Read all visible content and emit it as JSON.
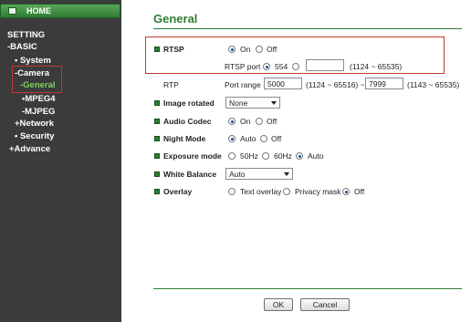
{
  "sidebar": {
    "home": "HOME",
    "items": [
      {
        "label": "SETTING"
      },
      {
        "label": "-BASIC"
      },
      {
        "label": "• System"
      },
      {
        "label": "-Camera"
      },
      {
        "label": "-General"
      },
      {
        "label": "•MPEG4"
      },
      {
        "label": "-MJPEG"
      },
      {
        "label": "+Network"
      },
      {
        "label": "• Security"
      },
      {
        "label": "+Advance"
      }
    ]
  },
  "main": {
    "title": "General",
    "rtsp": {
      "label": "RTSP",
      "on": "On",
      "off": "Off",
      "selected": "On"
    },
    "rtsp_port": {
      "label": "RTSP port",
      "default_value": "554",
      "custom_value": "",
      "range": "(1124 ~ 65535)",
      "selected": "554"
    },
    "rtp": {
      "label": "RTP",
      "port_range_label": "Port range",
      "from": "5000",
      "from_range": "(1124 ~ 65516) ~",
      "to": "7999",
      "to_range": "(1143 ~ 65535)"
    },
    "image_rotated": {
      "label": "Image rotated",
      "value": "None"
    },
    "audio_codec": {
      "label": "Audio Codec",
      "on": "On",
      "off": "Off",
      "selected": "On"
    },
    "night_mode": {
      "label": "Night Mode",
      "auto": "Auto",
      "off": "Off",
      "selected": "Auto"
    },
    "exposure_mode": {
      "label": "Exposure mode",
      "options": [
        "50Hz",
        "60Hz",
        "Auto"
      ],
      "selected": "Auto"
    },
    "white_balance": {
      "label": "White Balance",
      "value": "Auto"
    },
    "overlay": {
      "label": "Overlay",
      "options": [
        "Text overlay",
        "Privacy mask",
        "Off"
      ],
      "selected": "Off"
    },
    "buttons": {
      "ok": "OK",
      "cancel": "Cancel"
    }
  },
  "colors": {
    "sidebar_bg": "#3b3b3b",
    "accent_green": "#2e7d32",
    "active_nav": "#7fd35b",
    "highlight_red": "#c0392b"
  }
}
